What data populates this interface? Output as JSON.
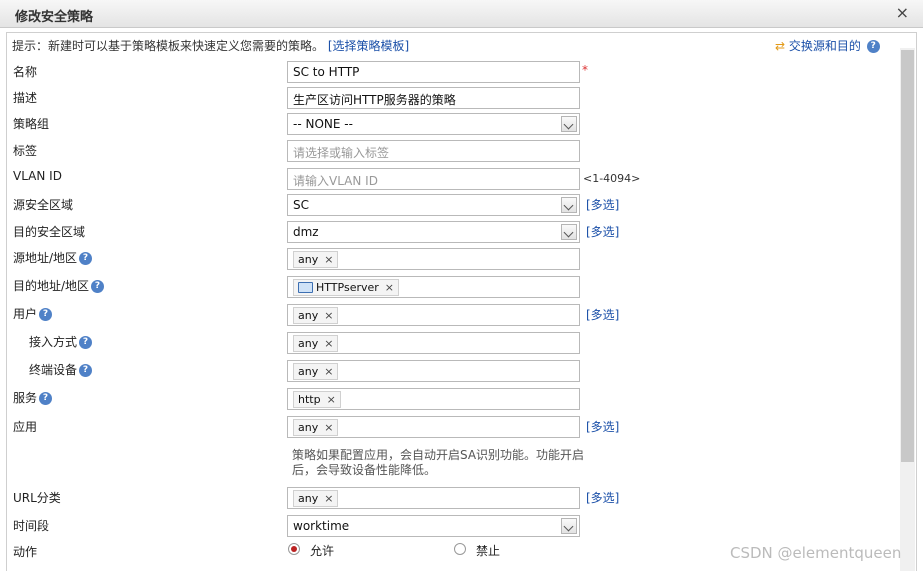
{
  "title": "修改安全策略",
  "close_glyph": "×",
  "hint": {
    "text": "提示：新建时可以基于策略模板来快速定义您需要的策略。",
    "link": "[选择策略模板]"
  },
  "swap": {
    "icon": "swap-arrows-icon",
    "label": "交换源和目的"
  },
  "help_glyph": "?",
  "required_mark": "*",
  "tag_remove": "×",
  "multi_select": "[多选]",
  "fields": {
    "name": {
      "label": "名称",
      "value": "SC to HTTP"
    },
    "desc": {
      "label": "描述",
      "value": "生产区访问HTTP服务器的策略"
    },
    "group": {
      "label": "策略组",
      "value": "-- NONE --"
    },
    "tag": {
      "label": "标签",
      "placeholder": "请选择或输入标签"
    },
    "vlan": {
      "label": "VLAN ID",
      "placeholder": "请输入VLAN ID",
      "range": "<1-4094>"
    },
    "src_zone": {
      "label": "源安全区域",
      "value": "SC"
    },
    "dst_zone": {
      "label": "目的安全区域",
      "value": "dmz"
    },
    "src_addr": {
      "label": "源地址/地区",
      "tag": "any"
    },
    "dst_addr": {
      "label": "目的地址/地区",
      "tag": "HTTPserver",
      "tag_icon": "computer-icon"
    },
    "user": {
      "label": "用户",
      "tag": "any"
    },
    "access": {
      "label": "接入方式",
      "tag": "any"
    },
    "terminal": {
      "label": "终端设备",
      "tag": "any"
    },
    "service": {
      "label": "服务",
      "tag": "http"
    },
    "app": {
      "label": "应用",
      "tag": "any",
      "note": "策略如果配置应用，会自动开启SA识别功能。功能开启后，会导致设备性能降低。"
    },
    "url": {
      "label": "URL分类",
      "tag": "any"
    },
    "time": {
      "label": "时间段",
      "value": "worktime"
    },
    "action": {
      "label": "动作",
      "options": [
        "允许",
        "禁止"
      ],
      "selected": "允许"
    }
  },
  "watermark": "CSDN @elementqueen"
}
